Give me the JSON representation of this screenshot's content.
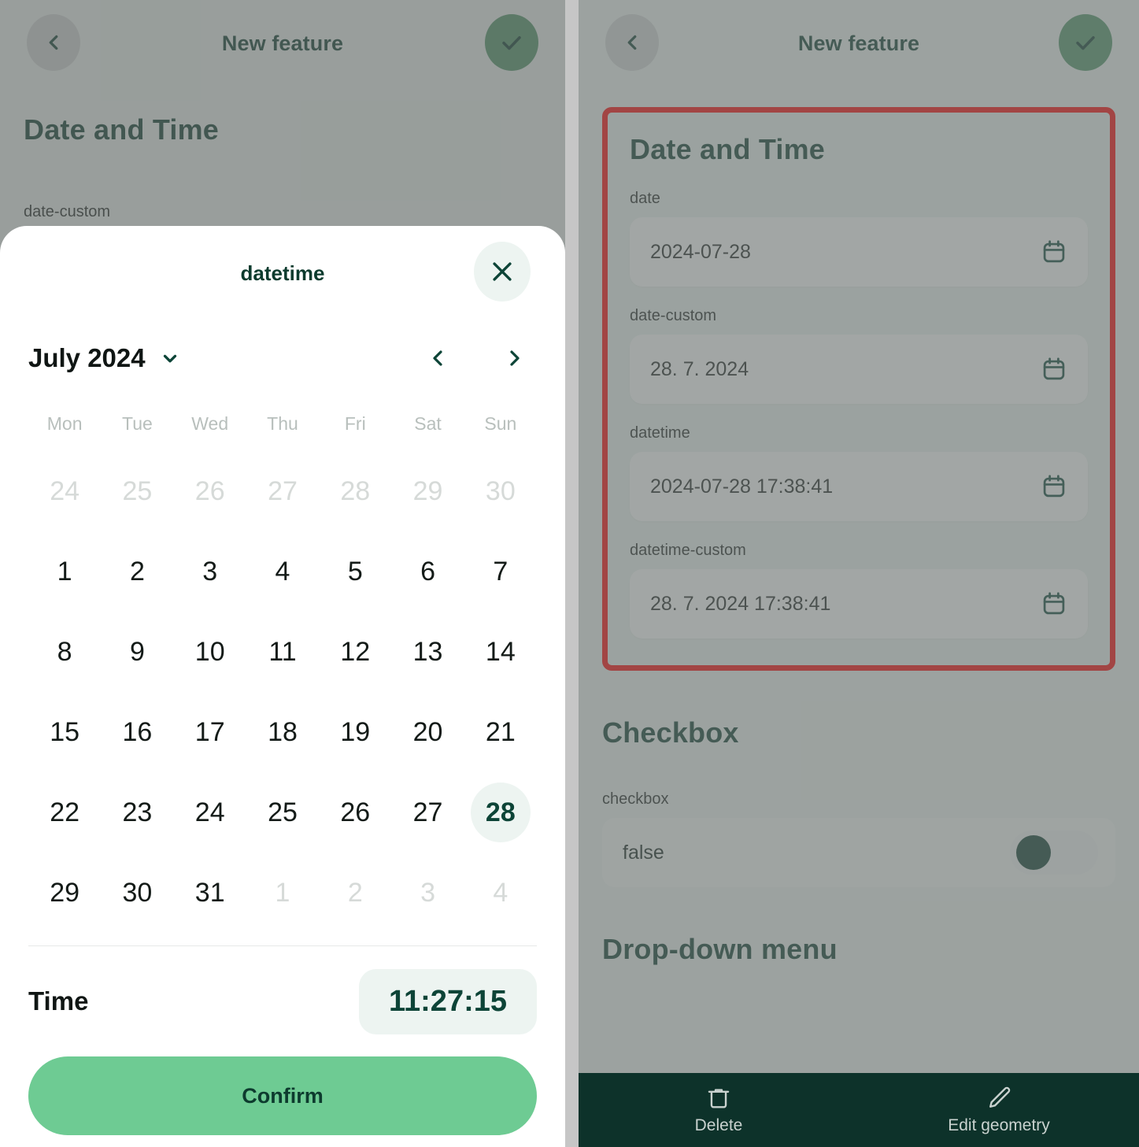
{
  "header": {
    "title": "New feature",
    "back_icon": "chevron-left-icon",
    "confirm_icon": "check-icon"
  },
  "sections": {
    "date_and_time": "Date and Time",
    "checkbox": "Checkbox",
    "dropdown": "Drop-down menu"
  },
  "fields": [
    {
      "label": "date",
      "value": "2024-07-28",
      "icon": "calendar-icon"
    },
    {
      "label": "date-custom",
      "value": "28. 7. 2024",
      "icon": "calendar-icon"
    },
    {
      "label": "datetime",
      "value": "2024-07-28 17:38:41",
      "icon": "calendar-icon"
    },
    {
      "label": "datetime-custom",
      "value": "28. 7. 2024 17:38:41",
      "icon": "calendar-icon"
    }
  ],
  "checkbox_field": {
    "label": "checkbox",
    "value": "false"
  },
  "bottom_bar": {
    "delete_label": "Delete",
    "delete_icon": "trash-icon",
    "edit_label": "Edit geometry",
    "edit_icon": "pencil-icon"
  },
  "picker_modal": {
    "title": "datetime",
    "close_icon": "close-icon",
    "month_label": "July 2024",
    "month_caret_icon": "chevron-down-icon",
    "prev_icon": "chevron-left-icon",
    "next_icon": "chevron-right-icon",
    "day_names": [
      "Mon",
      "Tue",
      "Wed",
      "Thu",
      "Fri",
      "Sat",
      "Sun"
    ],
    "weeks": [
      [
        {
          "d": "24",
          "state": "muted"
        },
        {
          "d": "25",
          "state": "muted"
        },
        {
          "d": "26",
          "state": "muted"
        },
        {
          "d": "27",
          "state": "muted"
        },
        {
          "d": "28",
          "state": "muted"
        },
        {
          "d": "29",
          "state": "muted"
        },
        {
          "d": "30",
          "state": "muted"
        }
      ],
      [
        {
          "d": "1",
          "state": "normal"
        },
        {
          "d": "2",
          "state": "normal"
        },
        {
          "d": "3",
          "state": "normal"
        },
        {
          "d": "4",
          "state": "normal"
        },
        {
          "d": "5",
          "state": "normal"
        },
        {
          "d": "6",
          "state": "normal"
        },
        {
          "d": "7",
          "state": "normal"
        }
      ],
      [
        {
          "d": "8",
          "state": "normal"
        },
        {
          "d": "9",
          "state": "normal"
        },
        {
          "d": "10",
          "state": "normal"
        },
        {
          "d": "11",
          "state": "normal"
        },
        {
          "d": "12",
          "state": "normal"
        },
        {
          "d": "13",
          "state": "normal"
        },
        {
          "d": "14",
          "state": "normal"
        }
      ],
      [
        {
          "d": "15",
          "state": "normal"
        },
        {
          "d": "16",
          "state": "normal"
        },
        {
          "d": "17",
          "state": "normal"
        },
        {
          "d": "18",
          "state": "normal"
        },
        {
          "d": "19",
          "state": "normal"
        },
        {
          "d": "20",
          "state": "normal"
        },
        {
          "d": "21",
          "state": "normal"
        }
      ],
      [
        {
          "d": "22",
          "state": "normal"
        },
        {
          "d": "23",
          "state": "normal"
        },
        {
          "d": "24",
          "state": "normal"
        },
        {
          "d": "25",
          "state": "normal"
        },
        {
          "d": "26",
          "state": "normal"
        },
        {
          "d": "27",
          "state": "normal"
        },
        {
          "d": "28",
          "state": "selected"
        }
      ],
      [
        {
          "d": "29",
          "state": "normal"
        },
        {
          "d": "30",
          "state": "normal"
        },
        {
          "d": "31",
          "state": "normal"
        },
        {
          "d": "1",
          "state": "muted"
        },
        {
          "d": "2",
          "state": "muted"
        },
        {
          "d": "3",
          "state": "muted"
        },
        {
          "d": "4",
          "state": "muted"
        }
      ]
    ],
    "time_label": "Time",
    "time_value": "11:27:15",
    "confirm_label": "Confirm"
  },
  "left_panel_background": {
    "partial_field_label": "date-custom"
  },
  "colors": {
    "brand_dark_green": "#0d3b2e",
    "confirm_green": "#6ecb93",
    "card_mint": "#edf4f1",
    "annotation_red": "#ff0000",
    "bottom_bar": "#0d322a",
    "dim_overlay": "#949c99"
  }
}
